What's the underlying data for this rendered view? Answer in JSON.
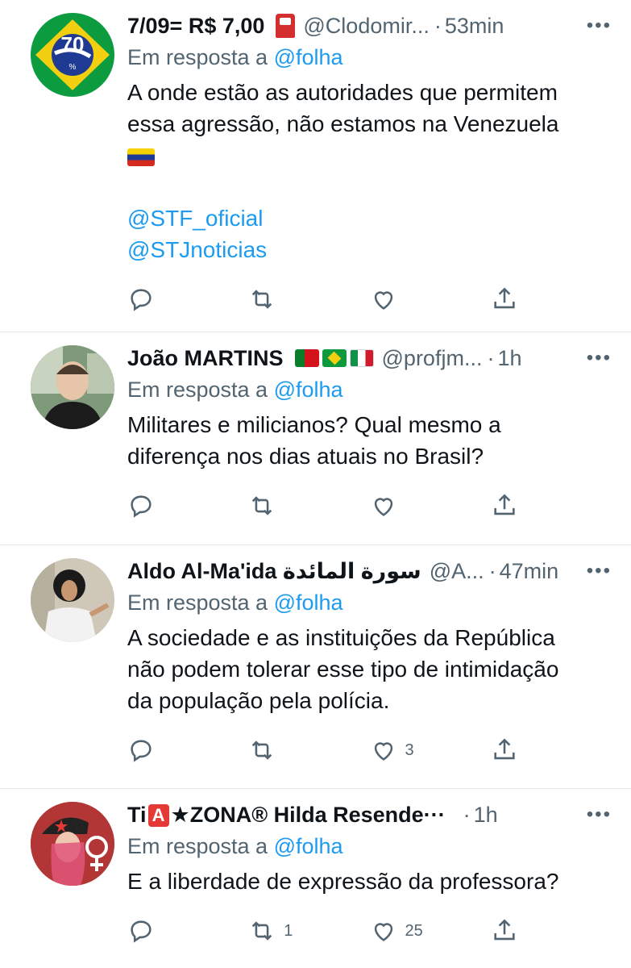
{
  "tweets": [
    {
      "name": "7/09= R$ 7,00",
      "handle": "@Clodomir...",
      "time": "53min",
      "reply_prefix": "Em resposta a",
      "reply_to": "@folha",
      "text_lines": [
        "A onde estão as autoridades que permitem",
        "essa agressão, não estamos na Venezuela"
      ],
      "links": [
        "@STF_oficial",
        "@STJnoticias"
      ],
      "retweets": "",
      "likes": ""
    },
    {
      "name": "João MARTINS",
      "handle": "@profjm...",
      "time": "1h",
      "reply_prefix": "Em resposta a",
      "reply_to": "@folha",
      "text_lines": [
        "Militares e milicianos? Qual mesmo a",
        "diferença nos dias atuais no Brasil?"
      ],
      "retweets": "",
      "likes": ""
    },
    {
      "name": "Aldo Al-Ma'ida سورة المائدة",
      "handle": "@A...",
      "time": "47min",
      "reply_prefix": "Em resposta a",
      "reply_to": "@folha",
      "text_lines": [
        "A sociedade e as instituições da República",
        "não podem tolerar esse tipo de intimidação",
        "da população pela polícia."
      ],
      "retweets": "",
      "likes": "3"
    },
    {
      "name_prefix": "Ti",
      "name_badge": "A",
      "name_suffix": "★ZONA® Hilda Resende",
      "name_ellipsis": "···",
      "handle": "",
      "time": "1h",
      "reply_prefix": "Em resposta a",
      "reply_to": "@folha",
      "text_lines": [
        "E a liberdade de expressão da professora?"
      ],
      "retweets": "1",
      "likes": "25"
    }
  ],
  "more_label": "•••",
  "colors": {
    "link": "#1d9bf0",
    "muted": "#536471",
    "text": "#0f1419",
    "divider": "#e3e6e9"
  },
  "icons": [
    "reply-icon",
    "retweet-icon",
    "like-icon",
    "share-icon"
  ]
}
